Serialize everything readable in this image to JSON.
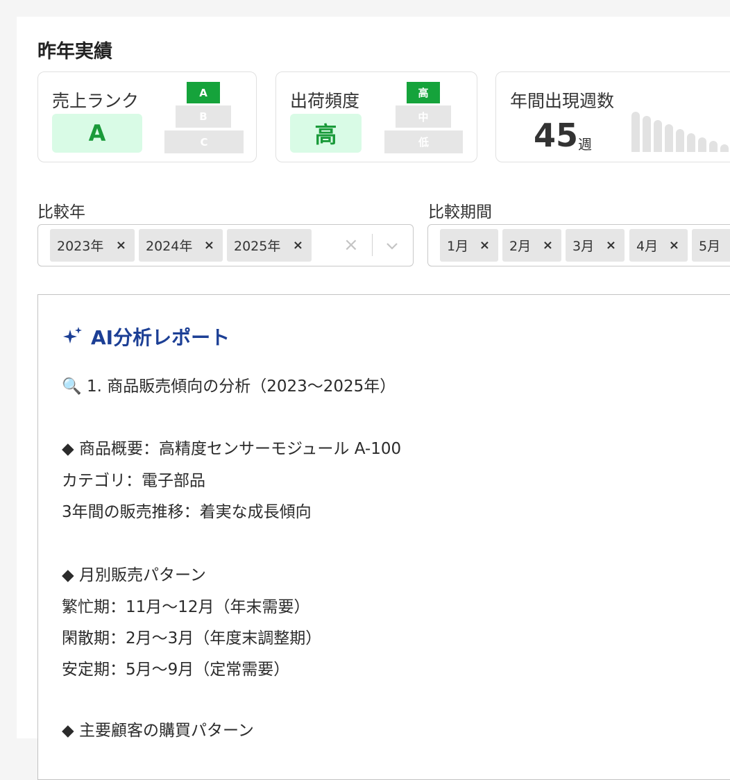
{
  "section_title": "昨年実績",
  "cards": {
    "rank": {
      "label": "売上ランク",
      "value": "A",
      "levels": [
        "A",
        "B",
        "C"
      ],
      "active": "A"
    },
    "freq": {
      "label": "出荷頻度",
      "value": "高",
      "levels": [
        "高",
        "中",
        "低"
      ],
      "active": "高"
    },
    "weeks": {
      "label": "年間出現週数",
      "value": "45",
      "unit": "週"
    }
  },
  "filters": {
    "year": {
      "label": "比較年",
      "chips": [
        "2023年",
        "2024年",
        "2025年"
      ],
      "chip_remove": "×",
      "clear": "×"
    },
    "period": {
      "label": "比較期間",
      "chips": [
        "1月",
        "2月",
        "3月",
        "4月",
        "5月"
      ],
      "chip_remove": "×"
    }
  },
  "report": {
    "title": "AI分析レポート",
    "lines": [
      "🔍 1. 商品販売傾向の分析（2023～2025年）",
      "◆ 商品概要：高精度センサーモジュール A-100",
      "カテゴリ：電子部品",
      "3年間の販売推移：着実な成長傾向",
      "◆ 月別販売パターン",
      "繁忙期：11月～12月（年末需要）",
      "閑散期：2月～3月（年度末調整期）",
      "安定期：5月～9月（定常需要）",
      "◆ 主要顧客の購買パターン"
    ]
  },
  "colors": {
    "accent_green": "#15a33b",
    "value_bg": "#d9fbe6",
    "report_title": "#1c3f95"
  },
  "icons": [
    "sparkle-icon",
    "magnifier-icon",
    "close-icon",
    "chevron-down-icon"
  ]
}
